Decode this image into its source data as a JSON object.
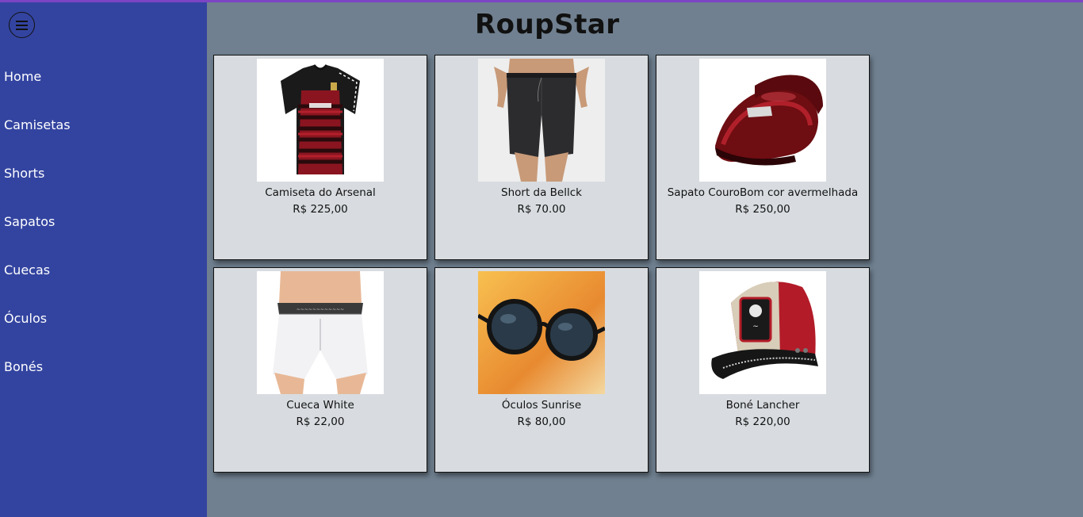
{
  "site": {
    "title": "RoupStar"
  },
  "colors": {
    "sidebar": "#3344a0",
    "background": "#708090",
    "card": "#d8dce0",
    "top_strip": "#7b45c4"
  },
  "sidebar": {
    "menu_icon": "hamburger-menu-icon",
    "items": [
      {
        "label": "Home"
      },
      {
        "label": "Camisetas"
      },
      {
        "label": "Shorts"
      },
      {
        "label": "Sapatos"
      },
      {
        "label": "Cuecas"
      },
      {
        "label": "Óculos"
      },
      {
        "label": "Bonés"
      }
    ]
  },
  "products": [
    {
      "name": "Camiseta do Arsenal",
      "price": "R$ 225,00",
      "image": "red-black-football-shirt"
    },
    {
      "name": "Short da Bellck",
      "price": "R$ 70.00",
      "image": "dark-grey-shorts"
    },
    {
      "name": "Sapato CouroBom cor avermelhada",
      "price": "R$ 250,00",
      "image": "red-leather-shoes"
    },
    {
      "name": "Cueca White",
      "price": "R$ 22,00",
      "image": "white-boxer-briefs"
    },
    {
      "name": "Óculos Sunrise",
      "price": "R$ 80,00",
      "image": "round-sunglasses"
    },
    {
      "name": "Boné Lancher",
      "price": "R$ 220,00",
      "image": "trucker-cap"
    }
  ]
}
